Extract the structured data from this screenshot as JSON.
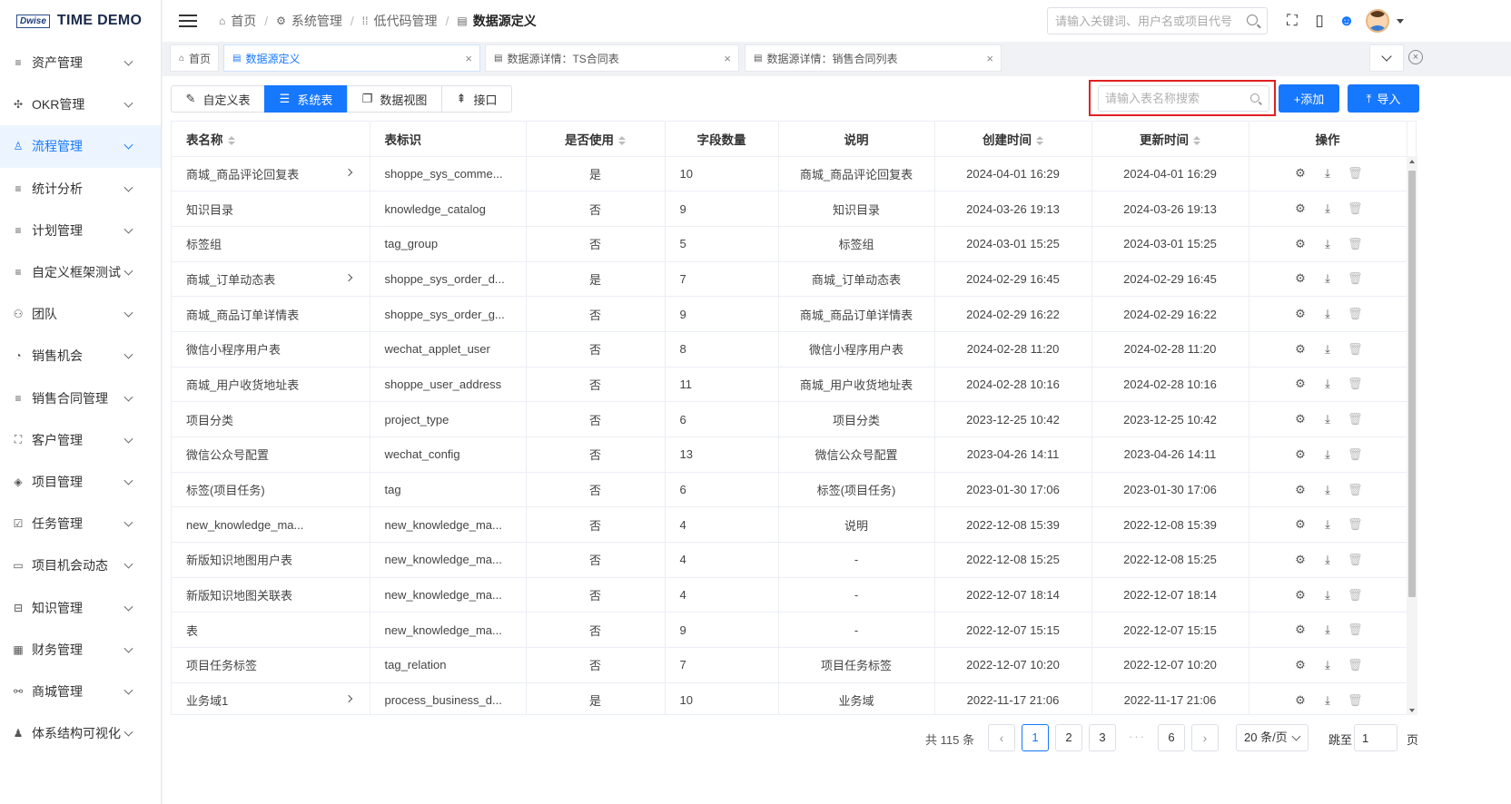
{
  "app": {
    "logo_mark": "Dwise",
    "title": "TIME DEMO"
  },
  "sidebar": {
    "items": [
      {
        "label": "资产管理",
        "icon": "menu-lines-icon",
        "glyph": "≡"
      },
      {
        "label": "OKR管理",
        "icon": "target-icon",
        "glyph": "✣"
      },
      {
        "label": "流程管理",
        "icon": "user-icon",
        "glyph": "♙",
        "active": true
      },
      {
        "label": "统计分析",
        "icon": "menu-lines-icon",
        "glyph": "≡"
      },
      {
        "label": "计划管理",
        "icon": "menu-lines-icon",
        "glyph": "≡"
      },
      {
        "label": "自定义框架测试",
        "icon": "menu-lines-icon",
        "glyph": "≡"
      },
      {
        "label": "团队",
        "icon": "team-icon",
        "glyph": "⚇"
      },
      {
        "label": "销售机会",
        "icon": "pie-icon",
        "glyph": "◔"
      },
      {
        "label": "销售合同管理",
        "icon": "menu-lines-icon",
        "glyph": "≡"
      },
      {
        "label": "客户管理",
        "icon": "scan-icon",
        "glyph": "⛶"
      },
      {
        "label": "项目管理",
        "icon": "layers-icon",
        "glyph": "◈"
      },
      {
        "label": "任务管理",
        "icon": "checklist-icon",
        "glyph": "☑"
      },
      {
        "label": "项目机会动态",
        "icon": "calendar-icon",
        "glyph": "▭"
      },
      {
        "label": "知识管理",
        "icon": "book-icon",
        "glyph": "⊟"
      },
      {
        "label": "财务管理",
        "icon": "grid-icon",
        "glyph": "▦"
      },
      {
        "label": "商城管理",
        "icon": "shop-icon",
        "glyph": "⚯"
      },
      {
        "label": "体系结构可视化",
        "icon": "person-icon",
        "glyph": "♟"
      }
    ]
  },
  "header": {
    "breadcrumbs": [
      {
        "label": "首页",
        "icon": "home-icon",
        "glyph": "⌂"
      },
      {
        "label": "系统管理",
        "icon": "gear-icon",
        "glyph": "⚙"
      },
      {
        "label": "低代码管理",
        "icon": "grid-dots-icon",
        "glyph": "⁞⁞"
      },
      {
        "label": "数据源定义",
        "icon": "doc-icon",
        "glyph": "▤"
      }
    ],
    "search_placeholder": "请输入关键词、用户名或项目代号"
  },
  "tabs": [
    {
      "label": "首页",
      "glyph": "⌂"
    },
    {
      "label": "数据源定义",
      "glyph": "▤",
      "active": true
    },
    {
      "label": "数据源详情：TS合同表",
      "glyph": "▤"
    },
    {
      "label": "数据源详情：销售合同列表",
      "glyph": "▤"
    }
  ],
  "toolbar": {
    "segments": [
      {
        "label": "自定义表",
        "glyph": "✎"
      },
      {
        "label": "系统表",
        "glyph": "☰",
        "active": true
      },
      {
        "label": "数据视图",
        "glyph": "❐"
      },
      {
        "label": "接口",
        "glyph": "⇞"
      }
    ],
    "table_search_placeholder": "请输入表名称搜索",
    "add_label": "+添加",
    "import_label": "导入",
    "import_glyph": "⤒"
  },
  "table": {
    "columns": [
      {
        "label": "表名称",
        "sortable": true
      },
      {
        "label": "表标识",
        "sortable": false
      },
      {
        "label": "是否使用",
        "sortable": true
      },
      {
        "label": "字段数量",
        "sortable": false
      },
      {
        "label": "说明",
        "sortable": false
      },
      {
        "label": "创建时间",
        "sortable": true
      },
      {
        "label": "更新时间",
        "sortable": true
      },
      {
        "label": "操作",
        "sortable": false
      }
    ],
    "rows": [
      {
        "name": "商城_商品评论回复表",
        "expand": true,
        "key": "shoppe_sys_comme...",
        "used": "是",
        "fields": "10",
        "desc": "商城_商品评论回复表",
        "created": "2024-04-01 16:29",
        "updated": "2024-04-01 16:29"
      },
      {
        "name": "知识目录",
        "expand": false,
        "key": "knowledge_catalog",
        "used": "否",
        "fields": "9",
        "desc": "知识目录",
        "created": "2024-03-26 19:13",
        "updated": "2024-03-26 19:13"
      },
      {
        "name": "标签组",
        "expand": false,
        "key": "tag_group",
        "used": "否",
        "fields": "5",
        "desc": "标签组",
        "created": "2024-03-01 15:25",
        "updated": "2024-03-01 15:25"
      },
      {
        "name": "商城_订单动态表",
        "expand": true,
        "key": "shoppe_sys_order_d...",
        "used": "是",
        "fields": "7",
        "desc": "商城_订单动态表",
        "created": "2024-02-29 16:45",
        "updated": "2024-02-29 16:45"
      },
      {
        "name": "商城_商品订单详情表",
        "expand": false,
        "key": "shoppe_sys_order_g...",
        "used": "否",
        "fields": "9",
        "desc": "商城_商品订单详情表",
        "created": "2024-02-29 16:22",
        "updated": "2024-02-29 16:22"
      },
      {
        "name": "微信小程序用户表",
        "expand": false,
        "key": "wechat_applet_user",
        "used": "否",
        "fields": "8",
        "desc": "微信小程序用户表",
        "created": "2024-02-28 11:20",
        "updated": "2024-02-28 11:20"
      },
      {
        "name": "商城_用户收货地址表",
        "expand": false,
        "key": "shoppe_user_address",
        "used": "否",
        "fields": "11",
        "desc": "商城_用户收货地址表",
        "created": "2024-02-28 10:16",
        "updated": "2024-02-28 10:16"
      },
      {
        "name": "项目分类",
        "expand": false,
        "key": "project_type",
        "used": "否",
        "fields": "6",
        "desc": "项目分类",
        "created": "2023-12-25 10:42",
        "updated": "2023-12-25 10:42"
      },
      {
        "name": "微信公众号配置",
        "expand": false,
        "key": "wechat_config",
        "used": "否",
        "fields": "13",
        "desc": "微信公众号配置",
        "created": "2023-04-26 14:11",
        "updated": "2023-04-26 14:11"
      },
      {
        "name": "标签(项目任务)",
        "expand": false,
        "key": "tag",
        "used": "否",
        "fields": "6",
        "desc": "标签(项目任务)",
        "created": "2023-01-30 17:06",
        "updated": "2023-01-30 17:06"
      },
      {
        "name": "new_knowledge_ma...",
        "expand": false,
        "key": "new_knowledge_ma...",
        "used": "否",
        "fields": "4",
        "desc": "说明",
        "created": "2022-12-08 15:39",
        "updated": "2022-12-08 15:39"
      },
      {
        "name": "新版知识地图用户表",
        "expand": false,
        "key": "new_knowledge_ma...",
        "used": "否",
        "fields": "4",
        "desc": "-",
        "created": "2022-12-08 15:25",
        "updated": "2022-12-08 15:25"
      },
      {
        "name": "新版知识地图关联表",
        "expand": false,
        "key": "new_knowledge_ma...",
        "used": "否",
        "fields": "4",
        "desc": "-",
        "created": "2022-12-07 18:14",
        "updated": "2022-12-07 18:14"
      },
      {
        "name": "表",
        "expand": false,
        "key": "new_knowledge_ma...",
        "used": "否",
        "fields": "9",
        "desc": "-",
        "created": "2022-12-07 15:15",
        "updated": "2022-12-07 15:15"
      },
      {
        "name": "项目任务标签",
        "expand": false,
        "key": "tag_relation",
        "used": "否",
        "fields": "7",
        "desc": "项目任务标签",
        "created": "2022-12-07 10:20",
        "updated": "2022-12-07 10:20"
      },
      {
        "name": "业务域1",
        "expand": true,
        "key": "process_business_d...",
        "used": "是",
        "fields": "10",
        "desc": "业务域",
        "created": "2022-11-17 21:06",
        "updated": "2022-11-17 21:06"
      }
    ],
    "ops": [
      {
        "name": "settings-icon",
        "glyph": "⚙"
      },
      {
        "name": "download-icon",
        "glyph": "⤓"
      },
      {
        "name": "trash-icon",
        "glyph": "🗑"
      }
    ]
  },
  "pagination": {
    "total": "共 115 条",
    "prev": "‹",
    "next": "›",
    "pages": [
      "1",
      "2",
      "3",
      "6"
    ],
    "current": "1",
    "ellipsis": "···",
    "page_size": "20 条/页",
    "goto_label": "跳至",
    "goto_value": "1",
    "page_suffix": "页"
  }
}
